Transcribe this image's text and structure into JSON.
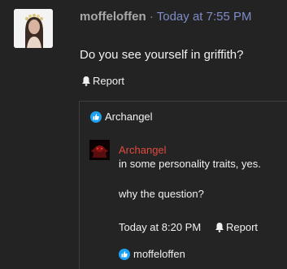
{
  "post": {
    "author": "moffeloffen",
    "separator": "·",
    "time": "Today at 7:55 PM",
    "body": "Do you see yourself in griffith?",
    "report_label": "Report"
  },
  "reply_section": {
    "top_like_user": "Archangel",
    "reply": {
      "author": "Archangel",
      "line1": "in some personality traits, yes.",
      "line2": "why the question?",
      "time": "Today at 8:20 PM",
      "report_label": "Report"
    },
    "bottom_like_user": "moffeloffen"
  },
  "colors": {
    "background": "#232323",
    "timestamp": "#7f8cc6",
    "reply_author": "#e04a3f",
    "like_icon": "#1da1f2"
  },
  "icons": {
    "bell": "bell-icon",
    "like": "thumbs-up-icon"
  }
}
